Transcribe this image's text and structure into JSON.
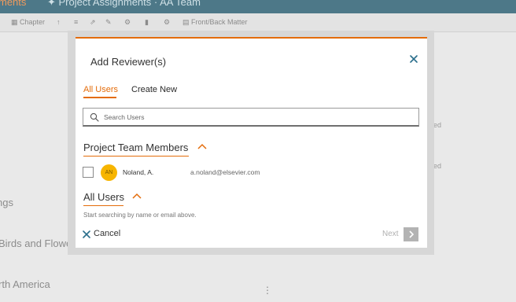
{
  "background": {
    "breadcrumb_current": "ments",
    "breadcrumb_path": "✦  Project Assignments  ·  AA Team",
    "toolbar": {
      "chapter": "Chapter",
      "front_back_matter": "Front/Back Matter"
    },
    "list_items": [
      "ngs",
      "Birds and Flowers",
      "rth America"
    ],
    "status_1": "sted",
    "status_2": "sted"
  },
  "modal": {
    "title": "Add Reviewer(s)",
    "tabs": [
      {
        "label": "All Users",
        "active": true
      },
      {
        "label": "Create New",
        "active": false
      }
    ],
    "search": {
      "placeholder": "Search Users",
      "value": ""
    },
    "project_team_section": {
      "heading": "Project Team Members",
      "members": [
        {
          "initials": "AN",
          "name": "Noland, A.",
          "email": "a.noland@elsevier.com",
          "checked": false
        }
      ]
    },
    "all_users_section": {
      "heading": "All Users",
      "hint": "Start searching by name or email above."
    },
    "footer": {
      "cancel_label": "Cancel",
      "next_label": "Next"
    }
  },
  "colors": {
    "accent": "#e46c0a",
    "close_icon": "#2b6f8c",
    "avatar": "#f7b500",
    "next_disabled": "#b3b3b3",
    "topbar": "#4d7888"
  },
  "icons": {
    "close": "close-icon",
    "search": "search-icon",
    "chevron_up": "chevron-up-icon",
    "cancel": "close-icon",
    "next": "chevron-right-icon"
  }
}
